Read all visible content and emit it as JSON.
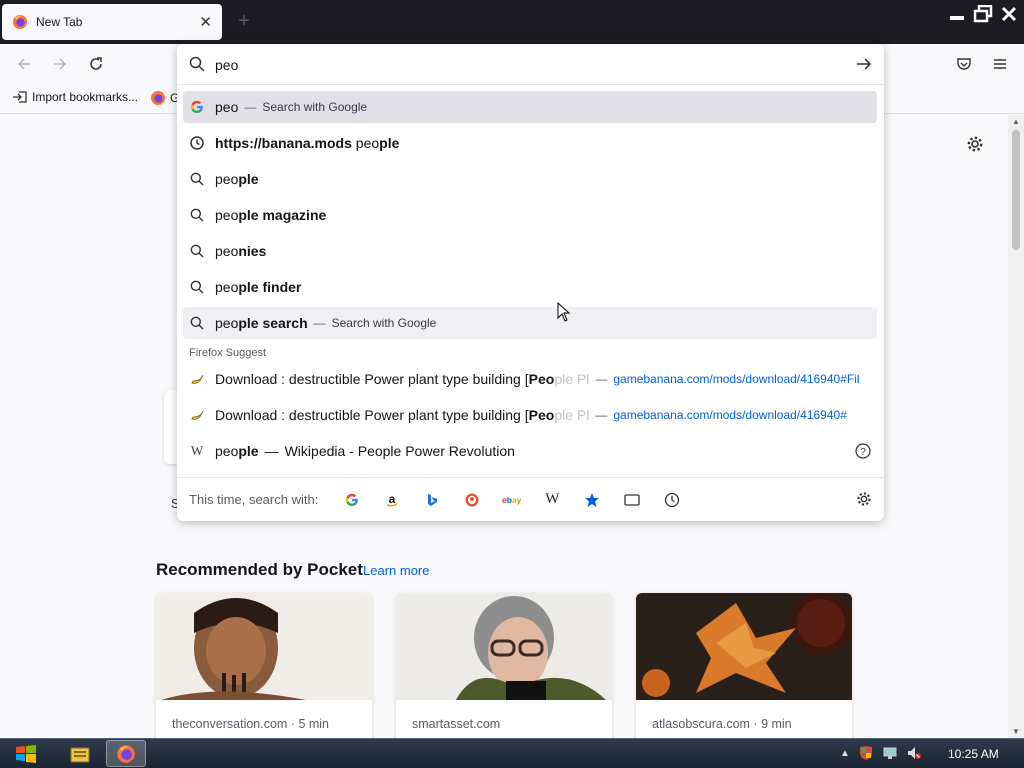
{
  "tab": {
    "title": "New Tab",
    "close": "✕",
    "new_tab": "+"
  },
  "bookmarks": {
    "import": "Import bookmarks...",
    "second": "G"
  },
  "urlbar": {
    "value": "peo",
    "results": [
      {
        "kind": "search-google",
        "typed": "peo",
        "bold": "",
        "action": "Search with Google",
        "icon": "google-icon",
        "selected": true
      },
      {
        "kind": "history",
        "pre_bold": "https://banana.mods",
        "typed": " peo",
        "bold": "ple",
        "icon": "history-clock-icon"
      },
      {
        "kind": "suggestion",
        "typed": "peo",
        "bold": "ple",
        "icon": "search-icon"
      },
      {
        "kind": "suggestion",
        "typed": "peo",
        "bold": "ple magazine",
        "icon": "search-icon"
      },
      {
        "kind": "suggestion",
        "typed": "peo",
        "bold": "nies",
        "icon": "search-icon"
      },
      {
        "kind": "suggestion",
        "typed": "peo",
        "bold": "ple finder",
        "icon": "search-icon"
      },
      {
        "kind": "suggestion-action",
        "typed": "peo",
        "bold": "ple search",
        "action": "Search with Google",
        "icon": "search-icon"
      }
    ],
    "firefox_suggest_label": "Firefox Suggest",
    "suggest": [
      {
        "pre": "Download : destructible Power plant type building [",
        "bold": "Peo",
        "post": "ple Pl",
        "url": "gamebanana.com/mods/download/416940#Fil",
        "icon": "banana-icon"
      },
      {
        "pre": "Download : destructible Power plant type building [",
        "bold": "Peo",
        "post": "ple Pl",
        "url": "gamebanana.com/mods/download/416940#",
        "icon": "banana-icon"
      },
      {
        "typed": "peo",
        "bold": "ple",
        "title": "Wikipedia - People Power Revolution",
        "icon": "wikipedia-icon"
      }
    ],
    "dash": "—",
    "engines_label": "This time, search with:",
    "engines": [
      "google-engine-icon",
      "amazon-engine-icon",
      "bing-engine-icon",
      "duckduckgo-engine-icon",
      "ebay-engine-icon",
      "wikipedia-engine-icon",
      "bookmarks-star-icon",
      "tabs-icon",
      "history-icon"
    ]
  },
  "pocket": {
    "title": "Recommended by Pocket",
    "learn_more": "Learn more",
    "cards": [
      {
        "source": "theconversation.com · 5 min"
      },
      {
        "source": "smartasset.com"
      },
      {
        "source": "atlasobscura.com · 9 min"
      }
    ]
  },
  "page": {
    "peek_letter": "S"
  },
  "taskbar": {
    "clock": "10:25 AM"
  },
  "colors": {
    "accent": "#0061e0",
    "tabstrip": "#1c1b22",
    "selected_row": "#e0e0e6"
  }
}
